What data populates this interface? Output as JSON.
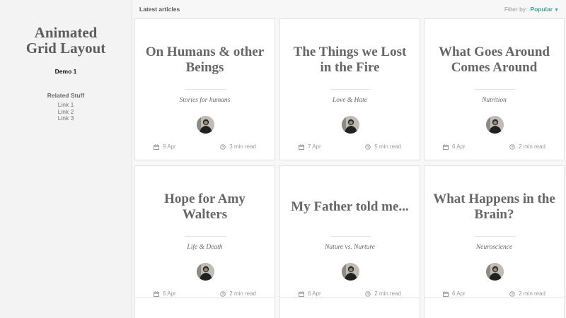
{
  "sidebar": {
    "title_line1": "Animated",
    "title_line2": "Grid Layout",
    "demo_label": "Demo 1",
    "related_heading": "Related Stuff",
    "links": [
      "Link 1",
      "Link 2",
      "Link 3"
    ]
  },
  "topbar": {
    "heading": "Latest articles",
    "filter_label": "Filter by:",
    "filter_value": "Popular"
  },
  "icons": {
    "date": "calendar-icon",
    "read_time": "clock-icon",
    "filter_caret": "caret-down-icon"
  },
  "articles": [
    {
      "title": "On Humans & other Beings",
      "category": "Stories for humans",
      "date": "9 Apr",
      "read_time": "3 min read"
    },
    {
      "title": "The Things we Lost in the Fire",
      "category": "Love & Hate",
      "date": "7 Apr",
      "read_time": "5 min read"
    },
    {
      "title": "What Goes Around Comes Around",
      "category": "Nutrition",
      "date": "6 Apr",
      "read_time": "2 min read"
    },
    {
      "title": "Hope for Amy Walters",
      "category": "Life & Death",
      "date": "6 Apr",
      "read_time": "2 min read"
    },
    {
      "title": "My Father told me...",
      "category": "Nature vs. Nurture",
      "date": "6 Apr",
      "read_time": "2 min read"
    },
    {
      "title": "What Happens in the Brain?",
      "category": "Neuroscience",
      "date": "6 Apr",
      "read_time": "2 min read"
    }
  ],
  "colors": {
    "accent": "#3ba5a0",
    "title_text": "#666666",
    "sidebar_bg": "#f3f3f3"
  }
}
